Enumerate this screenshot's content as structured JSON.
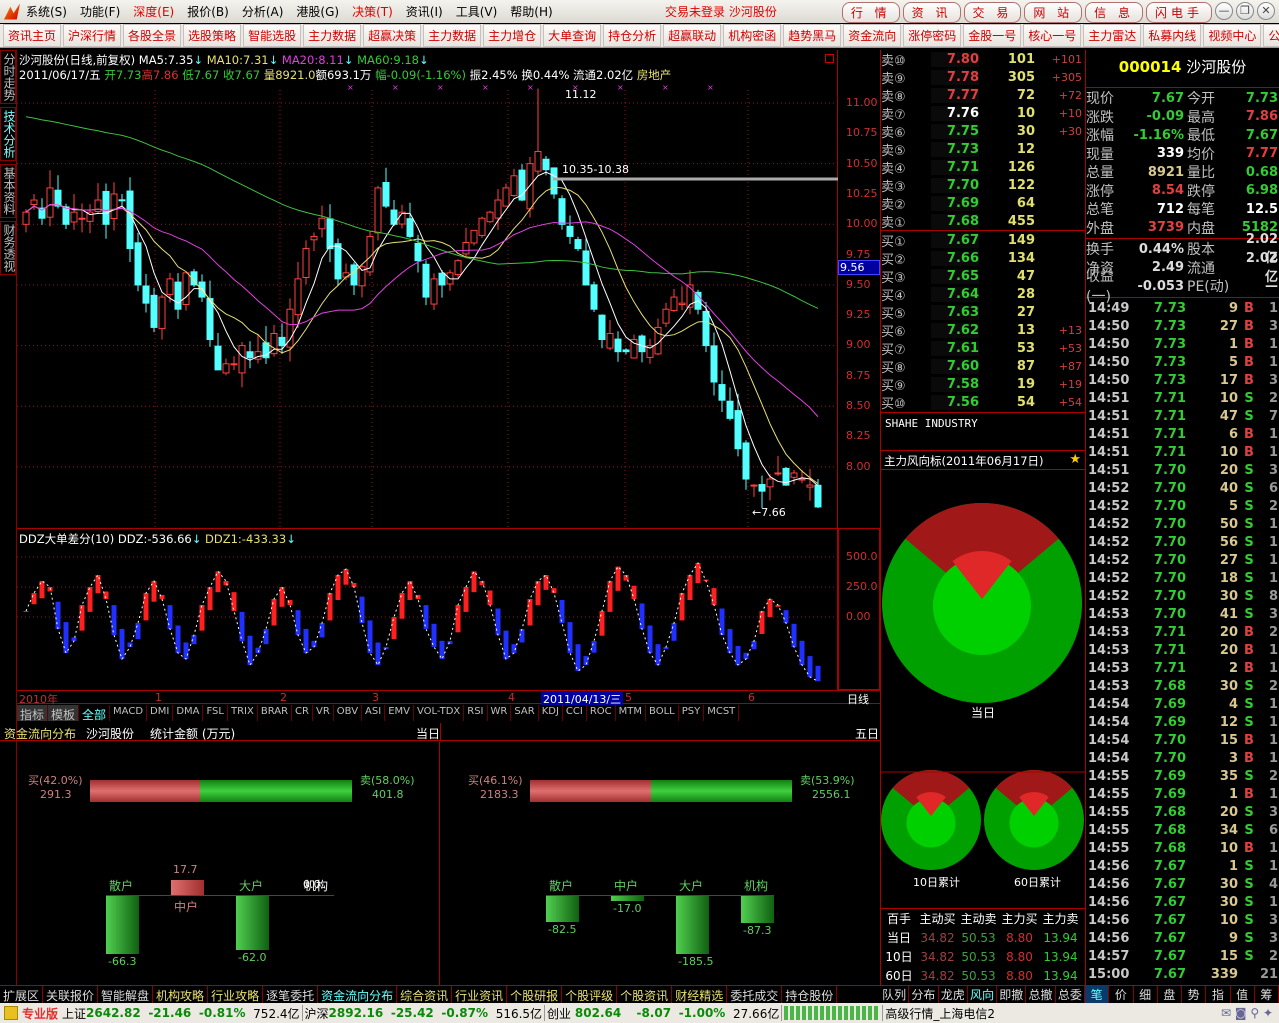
{
  "menubar": {
    "items": [
      "系统(S)",
      "功能(F)",
      "深度(E)",
      "报价(B)",
      "分析(A)",
      "港股(G)",
      "决策(T)",
      "资讯(I)",
      "工具(V)",
      "帮助(H)"
    ],
    "red_items": [
      2,
      6
    ],
    "title": "交易未登录 沙河股份",
    "right_buttons": [
      "行 情",
      "资 讯",
      "交 易",
      "网 站",
      "信 息",
      "闪电手"
    ]
  },
  "toolbar": [
    "资讯主页",
    "沪深行情",
    "各股全景",
    "选股策略",
    "智能选股",
    "主力数据",
    "超赢决策",
    "主力数据",
    "主力增仓",
    "大单查询",
    "持仓分析",
    "超赢联动",
    "机构密函",
    "趋势黑马",
    "资金流向",
    "涨停密码",
    "金股一号",
    "核心一号",
    "主力雷达",
    "私募内线",
    "视频中心",
    "公"
  ],
  "vtabs": [
    "分时走势",
    "技术分析",
    "基本资料",
    "财务透视"
  ],
  "chart": {
    "header": {
      "name": "沙河股份(日线,前复权)",
      "ma5": "MA5:7.35",
      "ma10": "MA10:7.31",
      "ma20": "MA20:8.11",
      "ma60": "MA60:9.18",
      "arrow": "↓"
    },
    "info": {
      "date": "2011/06/17/五",
      "open": "开7.73",
      "high": "高7.86",
      "low": "低7.67",
      "close": "收7.67",
      "vol": "量8921.0",
      "amt": "额693.1万",
      "chg": "幅-0.09(-1.16%)",
      "amp": "振2.45%",
      "turn": "换0.44%",
      "float": "流通2.02亿",
      "sector": "房地产"
    },
    "annotations": {
      "max": "11.12",
      "range": "10.35-10.38",
      "min": "←7.66",
      "cursor_price": "9.56"
    },
    "ddz_header": {
      "name": "DDZ大单差分(10)",
      "ddz": "DDZ:-536.66",
      "ddz1": "DDZ1:-433.33"
    },
    "time_labels": [
      "2010年",
      "1",
      "2",
      "3",
      "4",
      "5",
      "6"
    ],
    "cursor_date": "2011/04/13/三",
    "period": "日线",
    "indicator_tabs": [
      "指标",
      "模板",
      "全部",
      "MACD",
      "DMI",
      "DMA",
      "FSL",
      "TRIX",
      "BRAR",
      "CR",
      "VR",
      "OBV",
      "ASI",
      "EMV",
      "VOL-TDX",
      "RSI",
      "WR",
      "SAR",
      "KDJ",
      "CCI",
      "ROC",
      "MTM",
      "BOLL",
      "PSY",
      "MCST"
    ]
  },
  "chart_data": [
    {
      "type": "candlestick",
      "title": "沙河股份(日线,前复权)",
      "ylim": [
        7.5,
        11.2
      ],
      "yticks": [
        "11.00",
        "10.75",
        "10.50",
        "10.25",
        "10.00",
        "9.75",
        "9.50",
        "9.25",
        "9.00",
        "8.75",
        "8.50",
        "8.25",
        "8.00"
      ],
      "closes": [
        10.1,
        10.2,
        10.05,
        10.3,
        10.15,
        10.0,
        10.1,
        10.05,
        10.1,
        10.2,
        10.0,
        10.25,
        10.2,
        9.8,
        9.5,
        9.35,
        9.15,
        9.4,
        9.55,
        9.3,
        9.6,
        9.5,
        9.4,
        9.05,
        8.8,
        8.85,
        8.85,
        9.0,
        8.9,
        8.95,
        8.9,
        9.1,
        9.0,
        9.3,
        9.55,
        9.8,
        9.9,
        10.05,
        9.8,
        9.55,
        9.6,
        9.5,
        9.65,
        9.9,
        10.3,
        10.15,
        10.0,
        10.1,
        9.9,
        9.7,
        9.4,
        9.55,
        9.5,
        9.6,
        9.7,
        9.85,
        9.95,
        10.05,
        10.1,
        10.2,
        10.3,
        10.4,
        10.2,
        10.5,
        10.6,
        10.45,
        10.25,
        10.0,
        9.9,
        9.8,
        9.5,
        9.3,
        9.05,
        9.1,
        8.95,
        8.95,
        9.05,
        8.95,
        9.0,
        9.15,
        9.3,
        9.4,
        9.35,
        9.5,
        9.3,
        9.0,
        8.7,
        8.55,
        8.4,
        8.15,
        7.9,
        7.85,
        7.8,
        7.9,
        7.95,
        7.85,
        7.95,
        7.9,
        7.85,
        7.67
      ],
      "max_point": {
        "index": 64,
        "value": 11.12
      },
      "min_point": {
        "index": 92,
        "value": 7.66
      },
      "series": [
        "MA5",
        "MA10",
        "MA20",
        "MA60"
      ],
      "colors": {
        "MA5": "#ffffff",
        "MA10": "#e8e070",
        "MA20": "#e040e0",
        "MA60": "#40c040"
      }
    },
    {
      "type": "bar",
      "title": "DDZ大单差分(10)",
      "yticks": [
        "500.0",
        "250.0",
        "0.00"
      ],
      "values": [
        50,
        200,
        300,
        250,
        -100,
        -300,
        -200,
        100,
        250,
        350,
        150,
        -150,
        -350,
        -250,
        -50,
        200,
        300,
        150,
        -100,
        -300,
        -350,
        -150,
        100,
        250,
        380,
        300,
        50,
        -200,
        -400,
        -300,
        -100,
        150,
        250,
        100,
        -150,
        -300,
        -250,
        -50,
        200,
        350,
        400,
        250,
        -50,
        -300,
        -400,
        -250,
        0,
        200,
        300,
        150,
        -100,
        -250,
        -350,
        -200,
        100,
        250,
        380,
        300,
        100,
        -150,
        -350,
        -300,
        -100,
        150,
        300,
        350,
        200,
        -50,
        -300,
        -450,
        -400,
        -200,
        50,
        300,
        420,
        350,
        150,
        -100,
        -300,
        -400,
        -250,
        -50,
        200,
        350,
        450,
        300,
        100,
        -150,
        -300,
        -400,
        -350,
        -200,
        50,
        150,
        100,
        -50,
        -250,
        -400,
        -500,
        -536
      ]
    }
  ],
  "fund": {
    "title": "资金流向分布",
    "stock": "沙河股份",
    "unit": "统计金额 (万元)",
    "today": {
      "label": "当日",
      "buy_label": "买(42.0%)",
      "buy": "291.3",
      "buy_pct": 42.0,
      "sell_label": "卖(58.0%)",
      "sell": "401.8",
      "cats": [
        {
          "name": "散户",
          "value": -66.3,
          "text": "-66.3"
        },
        {
          "name": "中户",
          "value": 17.7,
          "text": "17.7"
        },
        {
          "name": "大户",
          "value": -62.0,
          "text": "-62.0"
        },
        {
          "name": "机构",
          "value": 0.0,
          "text": "0.0"
        }
      ]
    },
    "five": {
      "label": "五日",
      "buy_label": "买(46.1%)",
      "buy": "2183.3",
      "buy_pct": 46.1,
      "sell_label": "卖(53.9%)",
      "sell": "2556.1",
      "cats": [
        {
          "name": "散户",
          "value": -82.5,
          "text": "-82.5"
        },
        {
          "name": "中户",
          "value": -17.0,
          "text": "-17.0"
        },
        {
          "name": "大户",
          "value": -185.5,
          "text": "-185.5"
        },
        {
          "name": "机构",
          "value": -87.3,
          "text": "-87.3"
        }
      ]
    }
  },
  "bottom_tabs": [
    "扩展区",
    "关联报价",
    "智能解盘",
    "机构攻略",
    "行业攻略",
    "逐笔委托",
    "资金流向分布",
    "综合资讯",
    "行业资讯",
    "个股研报",
    "个股评级",
    "个股资讯",
    "财经精选",
    "委托成交",
    "持仓股份"
  ],
  "book": {
    "sells": [
      [
        "卖⑩",
        "7.80",
        "101",
        "+101"
      ],
      [
        "卖⑨",
        "7.78",
        "305",
        "+305"
      ],
      [
        "卖⑧",
        "7.77",
        "72",
        "+72"
      ],
      [
        "卖⑦",
        "7.76",
        "10",
        "+10"
      ],
      [
        "卖⑥",
        "7.75",
        "30",
        "+30"
      ],
      [
        "卖⑤",
        "7.73",
        "12",
        ""
      ],
      [
        "卖④",
        "7.71",
        "126",
        ""
      ],
      [
        "卖③",
        "7.70",
        "122",
        ""
      ],
      [
        "卖②",
        "7.69",
        "64",
        ""
      ],
      [
        "卖①",
        "7.68",
        "455",
        ""
      ]
    ],
    "buys": [
      [
        "买①",
        "7.67",
        "149",
        ""
      ],
      [
        "买②",
        "7.66",
        "134",
        ""
      ],
      [
        "买③",
        "7.65",
        "47",
        ""
      ],
      [
        "买④",
        "7.64",
        "28",
        ""
      ],
      [
        "买⑤",
        "7.63",
        "27",
        ""
      ],
      [
        "买⑥",
        "7.62",
        "13",
        "+13"
      ],
      [
        "买⑦",
        "7.61",
        "53",
        "+53"
      ],
      [
        "买⑧",
        "7.60",
        "87",
        "+87"
      ],
      [
        "买⑨",
        "7.58",
        "19",
        "+19"
      ],
      [
        "买⑩",
        "7.56",
        "54",
        "+54"
      ]
    ],
    "prev_close": 7.76
  },
  "english_name": "SHAHE INDUSTRY",
  "wind": {
    "title": "主力风向标(2011年06月17日)",
    "labels": [
      "当日",
      "10日累计",
      "60日累计"
    ],
    "table": {
      "headers": [
        "百手",
        "主动买",
        "主动卖",
        "主力买",
        "主力卖"
      ],
      "rows": [
        [
          "当日",
          "34.82",
          "50.53",
          "8.80",
          "13.94"
        ],
        [
          "10日",
          "34.82",
          "50.53",
          "8.80",
          "13.94"
        ],
        [
          "60日",
          "34.82",
          "50.53",
          "8.80",
          "13.94"
        ]
      ]
    },
    "tabs": [
      "队列",
      "分布",
      "龙虎",
      "风向",
      "即撤",
      "总撤",
      "总委"
    ]
  },
  "quote": {
    "code": "000014",
    "name": "沙河股份",
    "rows": [
      [
        "现价",
        "7.67",
        "g",
        "今开",
        "7.73",
        "g"
      ],
      [
        "涨跌",
        "-0.09",
        "g",
        "最高",
        "7.86",
        "r"
      ],
      [
        "涨幅",
        "-1.16%",
        "g",
        "最低",
        "7.67",
        "g"
      ],
      [
        "现量",
        "339",
        "w",
        "均价",
        "7.77",
        "r"
      ],
      [
        "总量",
        "8921",
        "y",
        "量比",
        "0.68",
        "g"
      ],
      [
        "涨停",
        "8.54",
        "r",
        "跌停",
        "6.98",
        "g"
      ],
      [
        "总笔",
        "712",
        "w",
        "每笔",
        "12.5",
        "w"
      ],
      [
        "外盘",
        "3739",
        "r",
        "内盘",
        "5182",
        "g"
      ]
    ],
    "rows2": [
      [
        "换手",
        "0.44%",
        "股本",
        "2.02亿"
      ],
      [
        "净资",
        "2.49",
        "流通",
        "2.02亿"
      ],
      [
        "收益(一)",
        "-0.053",
        "PE(动)",
        "—"
      ]
    ]
  },
  "trades": [
    [
      "14:49",
      "7.73",
      "9",
      "B",
      "1"
    ],
    [
      "14:50",
      "7.73",
      "27",
      "B",
      "3"
    ],
    [
      "14:50",
      "7.73",
      "1",
      "B",
      "1"
    ],
    [
      "14:50",
      "7.73",
      "5",
      "B",
      "1"
    ],
    [
      "14:50",
      "7.73",
      "17",
      "B",
      "3"
    ],
    [
      "14:51",
      "7.71",
      "10",
      "S",
      "2"
    ],
    [
      "14:51",
      "7.71",
      "47",
      "S",
      "7"
    ],
    [
      "14:51",
      "7.71",
      "6",
      "B",
      "1"
    ],
    [
      "14:51",
      "7.71",
      "10",
      "B",
      "1"
    ],
    [
      "14:51",
      "7.70",
      "20",
      "S",
      "3"
    ],
    [
      "14:52",
      "7.70",
      "40",
      "S",
      "6"
    ],
    [
      "14:52",
      "7.70",
      "5",
      "S",
      "2"
    ],
    [
      "14:52",
      "7.70",
      "50",
      "S",
      "1"
    ],
    [
      "14:52",
      "7.70",
      "56",
      "S",
      "1"
    ],
    [
      "14:52",
      "7.70",
      "27",
      "S",
      "1"
    ],
    [
      "14:52",
      "7.70",
      "18",
      "S",
      "1"
    ],
    [
      "14:52",
      "7.70",
      "30",
      "S",
      "8"
    ],
    [
      "14:53",
      "7.70",
      "41",
      "S",
      "3"
    ],
    [
      "14:53",
      "7.71",
      "20",
      "B",
      "2"
    ],
    [
      "14:53",
      "7.71",
      "20",
      "B",
      "1"
    ],
    [
      "14:53",
      "7.71",
      "2",
      "B",
      "1"
    ],
    [
      "14:53",
      "7.68",
      "30",
      "S",
      "2"
    ],
    [
      "14:54",
      "7.69",
      "4",
      "S",
      "1"
    ],
    [
      "14:54",
      "7.69",
      "12",
      "S",
      "1"
    ],
    [
      "14:54",
      "7.70",
      "15",
      "B",
      "1"
    ],
    [
      "14:54",
      "7.70",
      "3",
      "B",
      "1"
    ],
    [
      "14:55",
      "7.69",
      "35",
      "S",
      "2"
    ],
    [
      "14:55",
      "7.69",
      "1",
      "B",
      "1"
    ],
    [
      "14:55",
      "7.68",
      "20",
      "S",
      "3"
    ],
    [
      "14:55",
      "7.68",
      "34",
      "S",
      "6"
    ],
    [
      "14:55",
      "7.68",
      "10",
      "B",
      "1"
    ],
    [
      "14:56",
      "7.67",
      "1",
      "S",
      "1"
    ],
    [
      "14:56",
      "7.67",
      "30",
      "S",
      "4"
    ],
    [
      "14:56",
      "7.67",
      "30",
      "S",
      "1"
    ],
    [
      "14:56",
      "7.67",
      "10",
      "S",
      "3"
    ],
    [
      "14:56",
      "7.67",
      "9",
      "S",
      "3"
    ],
    [
      "14:57",
      "7.67",
      "15",
      "S",
      "2"
    ],
    [
      "15:00",
      "7.67",
      "339",
      "",
      "21"
    ]
  ],
  "right_tabs": [
    "笔",
    "价",
    "细",
    "盘",
    "势",
    "指",
    "值",
    "筹"
  ],
  "status": {
    "edition": "专业版",
    "sh": {
      "name": "上证",
      "value": "2642.82",
      "chg": "-21.46",
      "pct": "-0.81%",
      "amt": "752.4亿"
    },
    "hs": {
      "name": "沪深",
      "value": "2892.16",
      "chg": "-25.42",
      "pct": "-0.87%",
      "amt": "516.5亿"
    },
    "cy": {
      "name": "创业",
      "value": "802.64",
      "chg": "-8.07",
      "pct": "-1.00%",
      "amt": "27.66亿"
    },
    "server": "高级行情_上海电信2"
  }
}
